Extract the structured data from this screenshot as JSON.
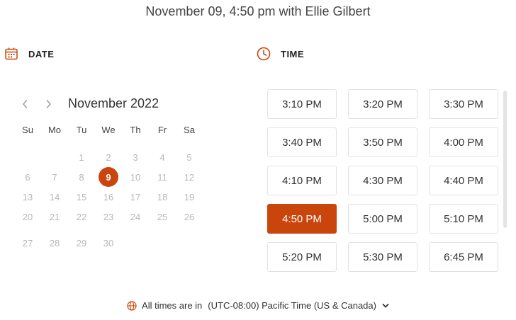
{
  "header": {
    "title": "November 09, 4:50 pm with Ellie Gilbert"
  },
  "date_section": {
    "label": "DATE",
    "icon": "calendar-icon"
  },
  "time_section": {
    "label": "TIME",
    "icon": "clock-icon"
  },
  "calendar": {
    "month_label": "November 2022",
    "weekdays": [
      "Su",
      "Mo",
      "Tu",
      "We",
      "Th",
      "Fr",
      "Sa"
    ],
    "selected_day": "9",
    "weeks": [
      [
        "",
        "",
        "1",
        "2",
        "3",
        "4",
        "5"
      ],
      [
        "6",
        "7",
        "8",
        "9",
        "10",
        "11",
        "12"
      ],
      [
        "13",
        "14",
        "15",
        "16",
        "17",
        "18",
        "19"
      ],
      [
        "20",
        "21",
        "22",
        "23",
        "24",
        "25",
        "26"
      ],
      [
        "27",
        "28",
        "29",
        "30",
        "",
        "",
        ""
      ]
    ]
  },
  "time_slots": {
    "selected": "4:50 PM",
    "slots": [
      "3:10 PM",
      "3:20 PM",
      "3:30 PM",
      "3:40 PM",
      "3:50 PM",
      "4:00 PM",
      "4:10 PM",
      "4:30 PM",
      "4:40 PM",
      "4:50 PM",
      "5:00 PM",
      "5:10 PM",
      "5:20 PM",
      "5:30 PM",
      "6:45 PM"
    ]
  },
  "timezone": {
    "prefix": "All times are in",
    "value": "(UTC-08:00) Pacific Time (US & Canada)"
  },
  "colors": {
    "accent": "#c9450c",
    "muted_day": "#b8b8b8",
    "border": "#e2e2e2"
  }
}
